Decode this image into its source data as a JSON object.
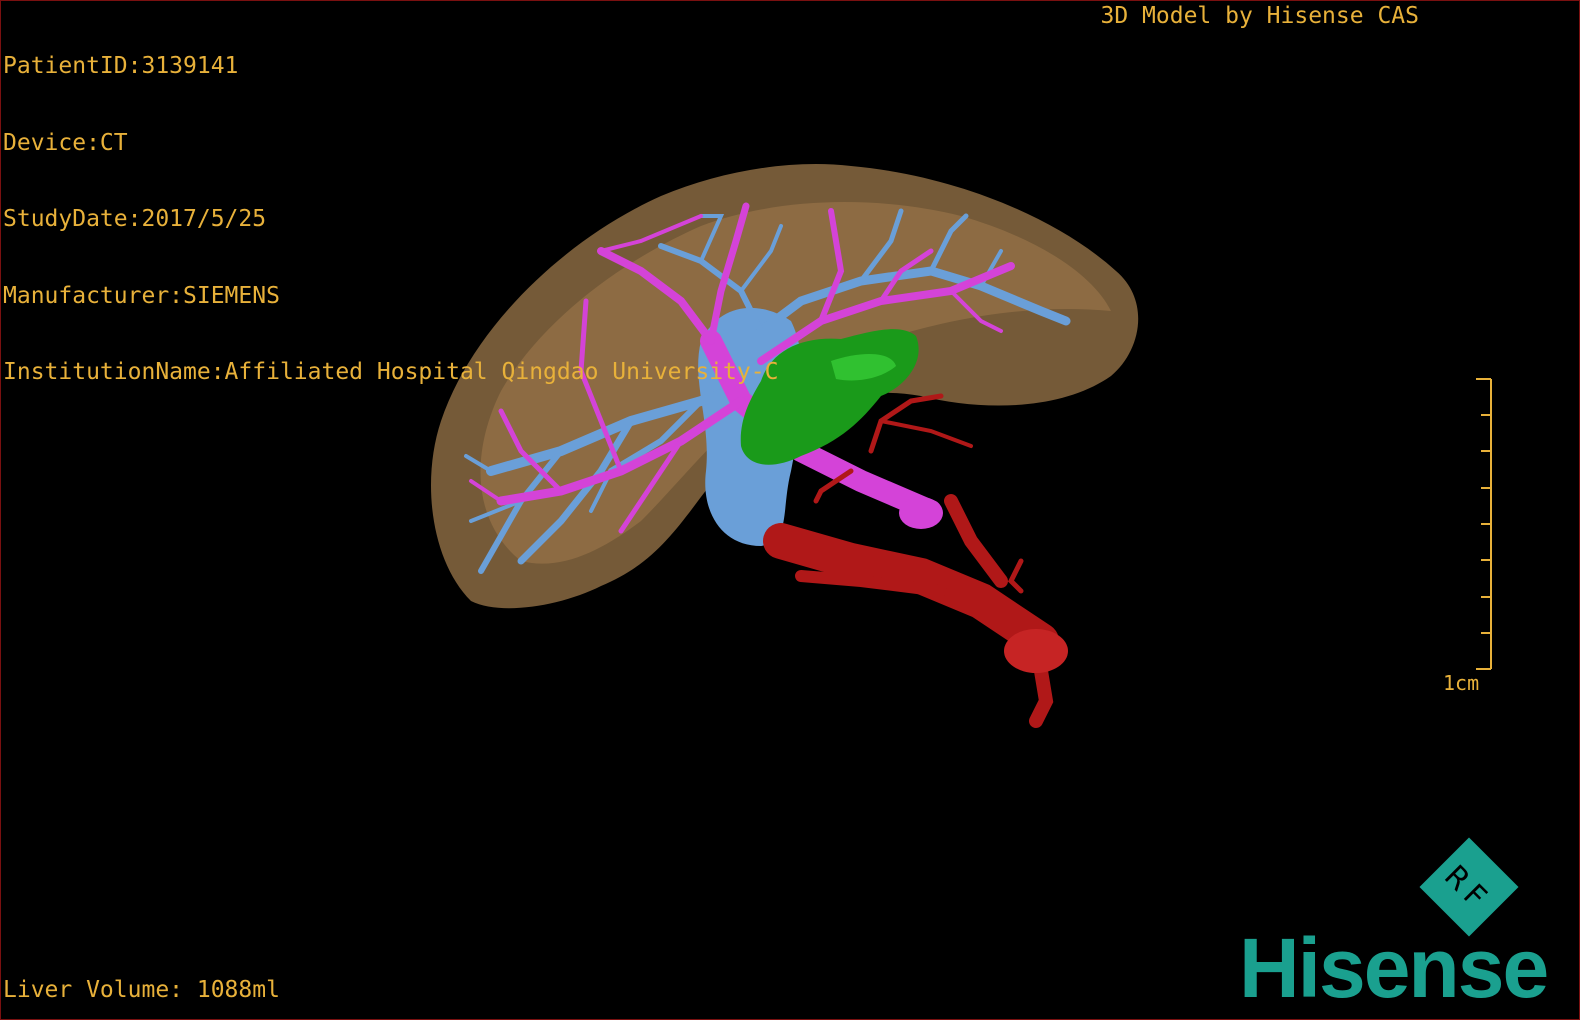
{
  "study": {
    "patient_id": "PatientID:3139141",
    "device": "Device:CT",
    "study_date": "StudyDate:2017/5/25",
    "manufacturer": "Manufacturer:SIEMENS",
    "institution": "InstitutionName:Affiliated Hospital Qingdao University-C"
  },
  "credit": "3D Model by Hisense CAS",
  "liver_volume": "Liver Volume: 1088ml",
  "scale_bar": {
    "label": "1cm"
  },
  "brand": {
    "name": "Hisense",
    "mark_text": "RF",
    "color": "#1aa08f"
  },
  "colors": {
    "overlay_text": "#e8b13a",
    "liver": "#a07a4c",
    "portal_vein": "#d443d8",
    "hepatic_vein": "#6a9fd8",
    "artery": "#b01818",
    "lesion": "#1a9a1a"
  }
}
